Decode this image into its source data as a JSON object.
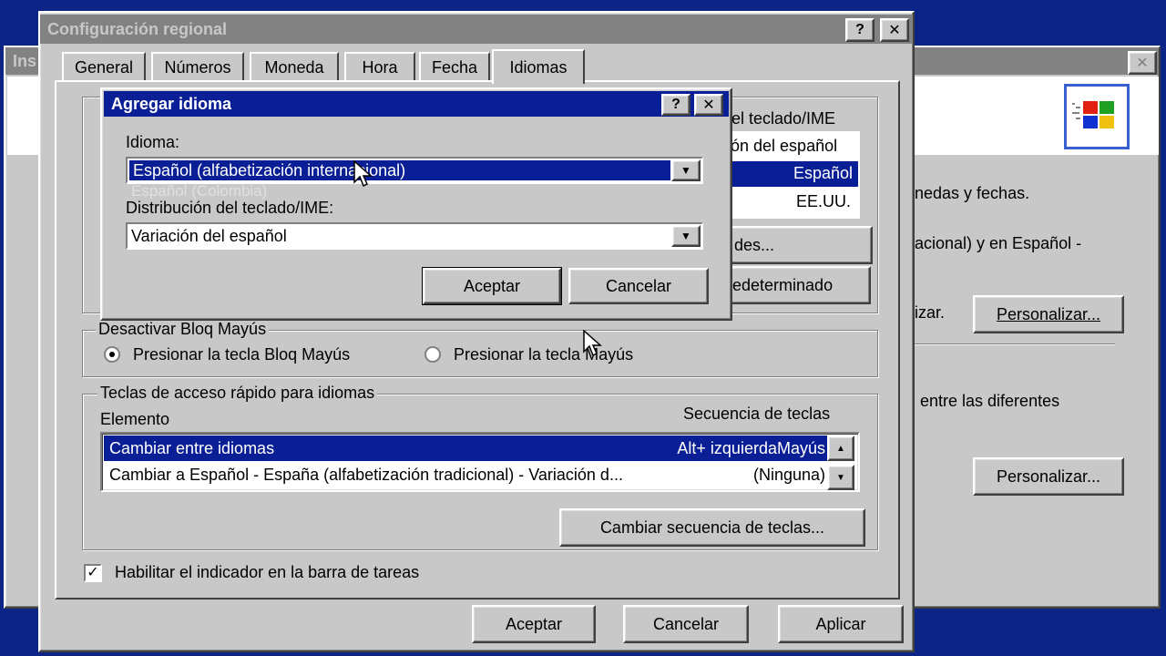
{
  "bg_window": {
    "title": "Ins",
    "line1": "nedas y fechas.",
    "line2": "acional) y en Español -",
    "line3": "izar.",
    "personalize1": "Personalizar...",
    "line4": "entre las diferentes",
    "personalize2": "Personalizar..."
  },
  "main_window": {
    "title": "Configuración regional",
    "help_label": "?",
    "close_label": "✕",
    "tabs": [
      {
        "label": "General"
      },
      {
        "label": "Números"
      },
      {
        "label": "Moneda"
      },
      {
        "label": "Hora"
      },
      {
        "label": "Fecha"
      },
      {
        "label": "Idiomas"
      }
    ],
    "partial": {
      "header": "el teclado/IME",
      "row1": "ón del español",
      "row2": "Español",
      "row3": "EE.UU.",
      "btn1": "des...",
      "btn2": "edeterminado"
    },
    "capslock": {
      "label": "Desactivar Bloq Mayús",
      "option1": "Presionar la tecla Bloq Mayús",
      "option2": "Presionar la tecla Mayús"
    },
    "hotkeys": {
      "label": "Teclas de acceso rápido para idiomas",
      "col_element": "Elemento",
      "col_sequence": "Secuencia de teclas",
      "rows": [
        {
          "element": "Cambiar entre idiomas",
          "sequence": "Alt+ izquierdaMayús"
        },
        {
          "element": "Cambiar a Español - España (alfabetización tradicional) - Variación d...",
          "sequence": "(Ninguna)"
        }
      ],
      "change_button": "Cambiar secuencia de teclas..."
    },
    "indicator_label": "Habilitar el indicador en la barra de tareas",
    "buttons": {
      "ok": "Aceptar",
      "cancel": "Cancelar",
      "apply": "Aplicar"
    }
  },
  "add_dialog": {
    "title": "Agregar idioma",
    "help_label": "?",
    "close_label": "✕",
    "language_label": "Idioma:",
    "language_value": "Español (alfabetización internacional)",
    "language_ghost": "Español (Colombia)",
    "layout_label": "Distribución del teclado/IME:",
    "layout_value": "Variación del español",
    "ok": "Aceptar",
    "cancel": "Cancelar"
  },
  "colors": {
    "desktop": "#0c2486",
    "active_title": "#0a1f95",
    "inactive_title": "#828282",
    "face": "#c8c8c8"
  }
}
